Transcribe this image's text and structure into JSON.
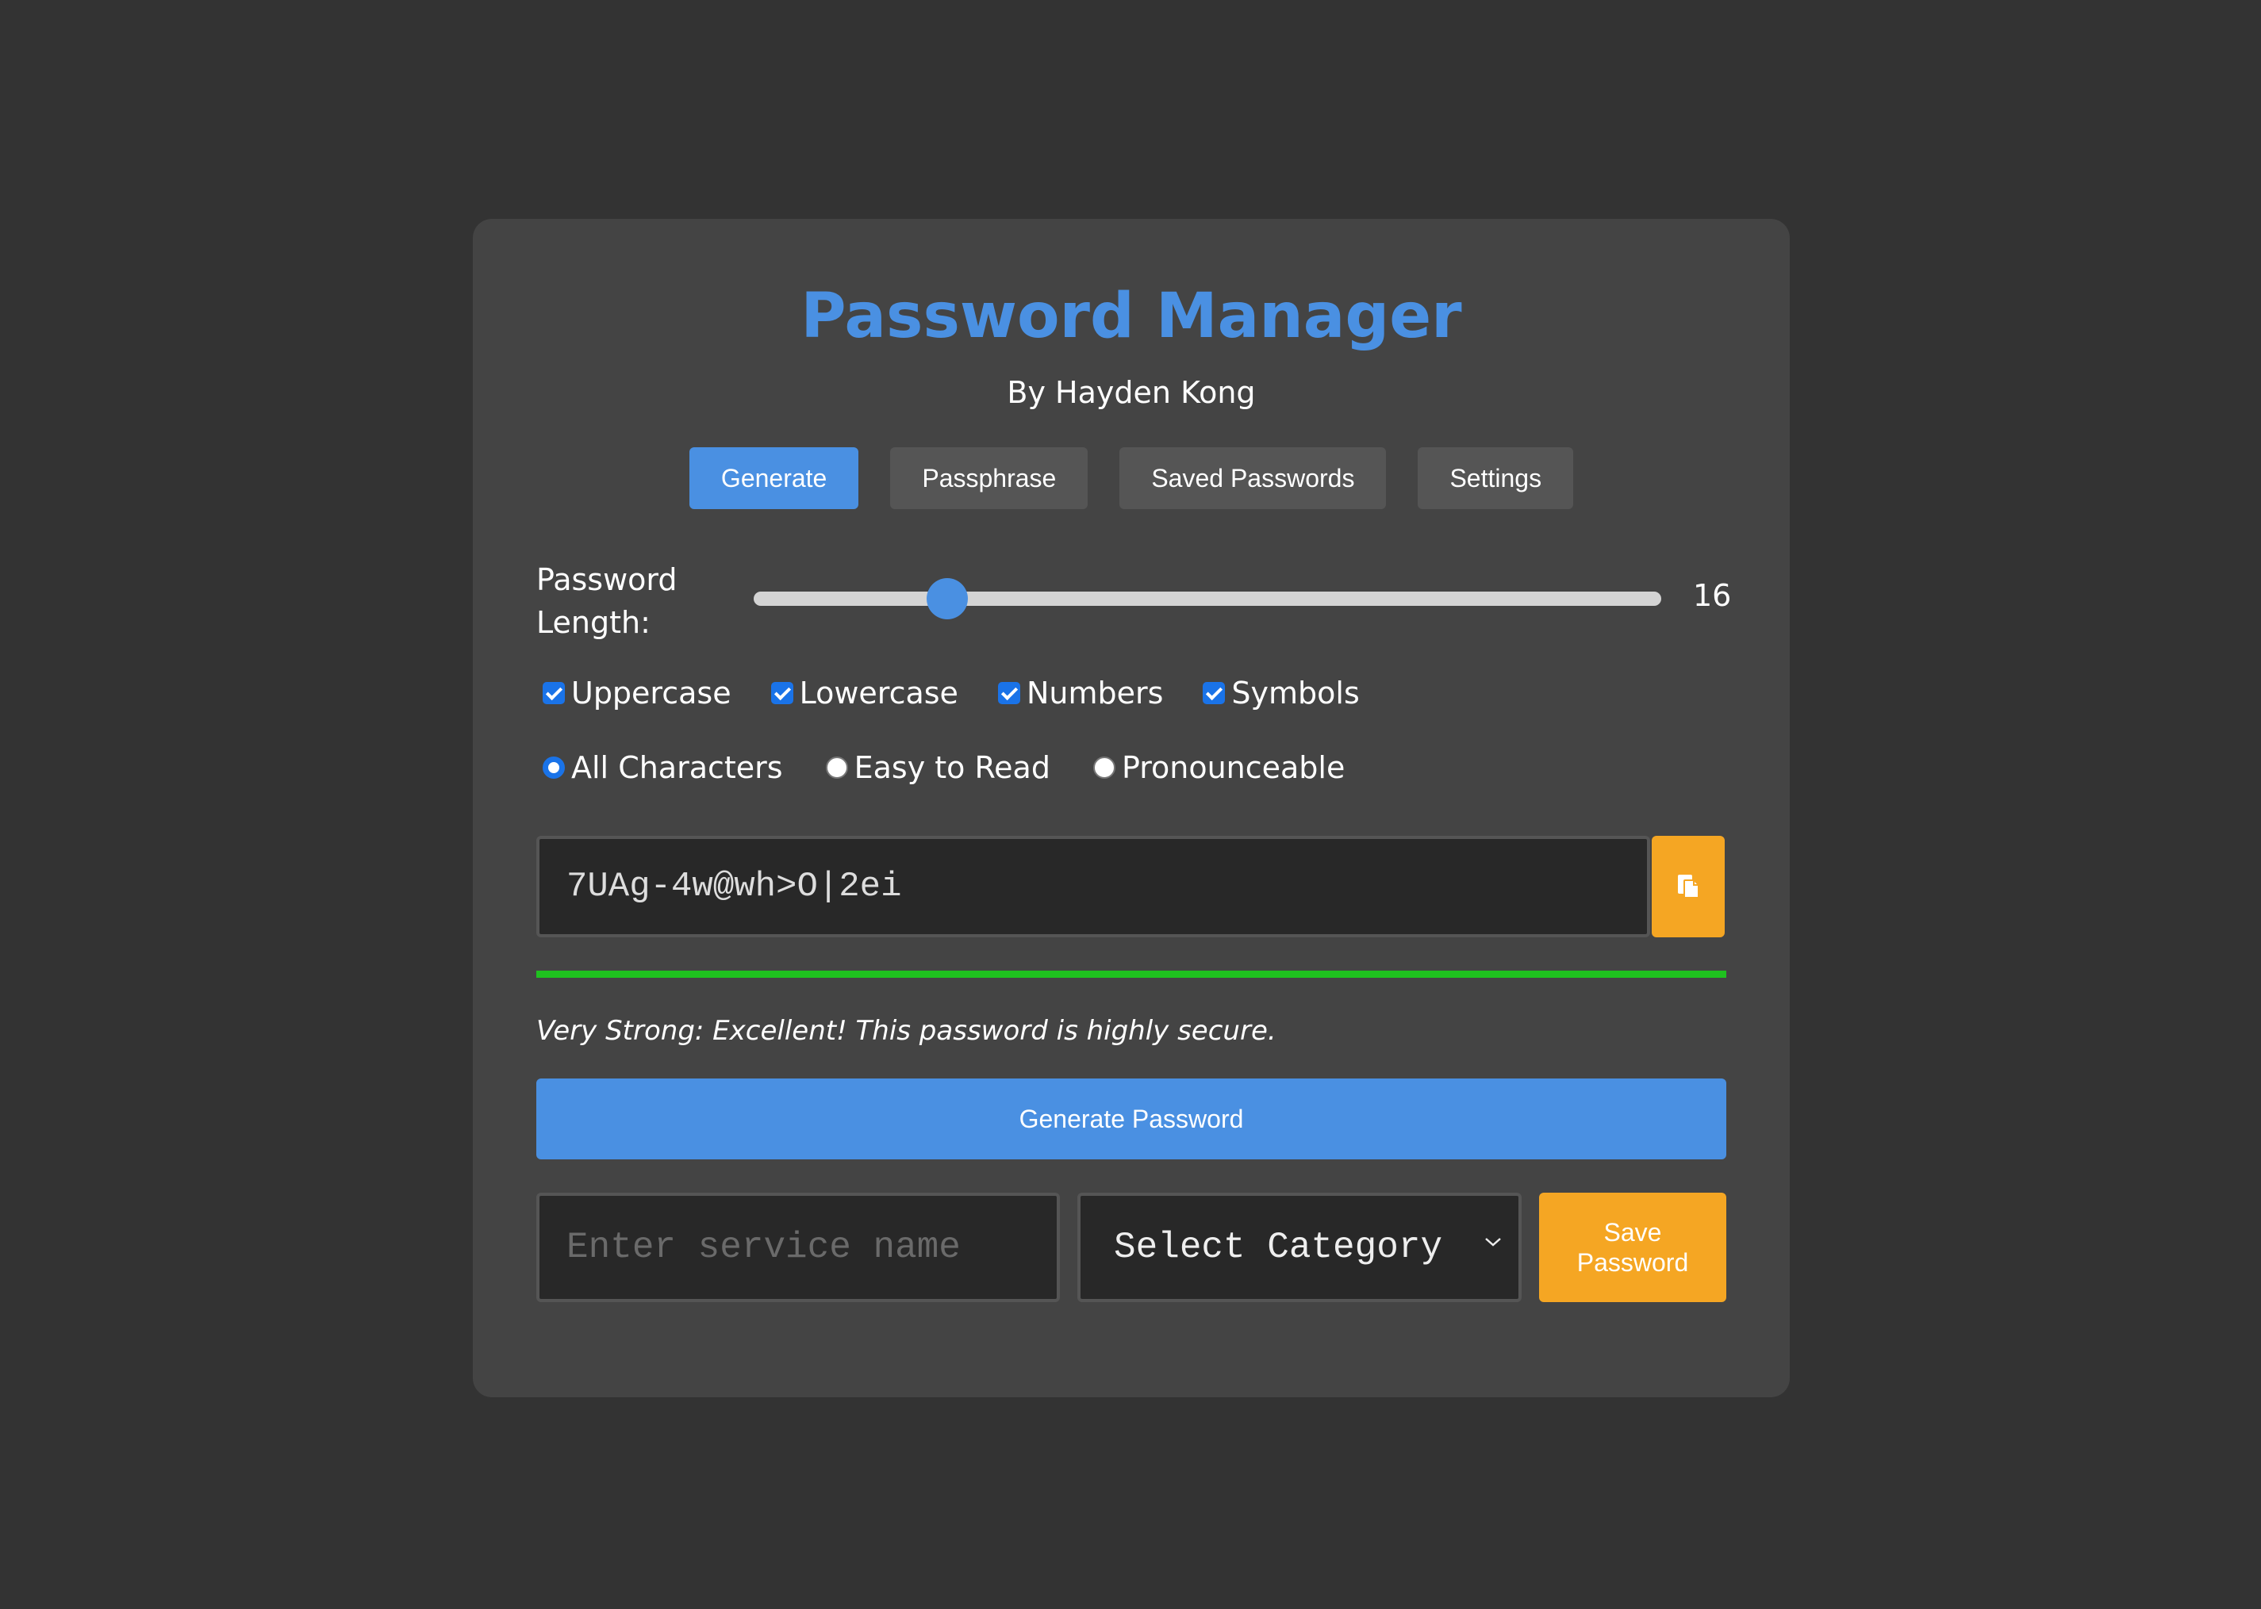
{
  "app": {
    "title": "Password Manager",
    "subtitle": "By Hayden Kong"
  },
  "tabs": [
    {
      "label": "Generate",
      "active": true
    },
    {
      "label": "Passphrase",
      "active": false
    },
    {
      "label": "Saved Passwords",
      "active": false
    },
    {
      "label": "Settings",
      "active": false
    }
  ],
  "length": {
    "label": "Password Length:",
    "value": "16",
    "min": 4,
    "max": 64,
    "level": 16
  },
  "checkboxes": [
    {
      "label": "Uppercase",
      "checked": true
    },
    {
      "label": "Lowercase",
      "checked": true
    },
    {
      "label": "Numbers",
      "checked": true
    },
    {
      "label": "Symbols",
      "checked": true
    }
  ],
  "modes": [
    {
      "label": "All Characters",
      "selected": true
    },
    {
      "label": "Easy to Read",
      "selected": false
    },
    {
      "label": "Pronounceable",
      "selected": false
    }
  ],
  "password": {
    "value": "7UAg-4w@wh>O|2ei",
    "copy_icon": "copy-icon"
  },
  "strength": {
    "level": 1.0,
    "color": "#1fc11f",
    "text": "Very Strong: Excellent! This password is highly secure."
  },
  "generate_button": "Generate Password",
  "save_form": {
    "service_placeholder": "Enter service name",
    "service_value": "",
    "category_selected": "Select Category",
    "save_label": "Save Password"
  },
  "colors": {
    "accent": "#4a90e2",
    "warning": "#f5a623",
    "background": "#333333",
    "card": "#444444"
  }
}
